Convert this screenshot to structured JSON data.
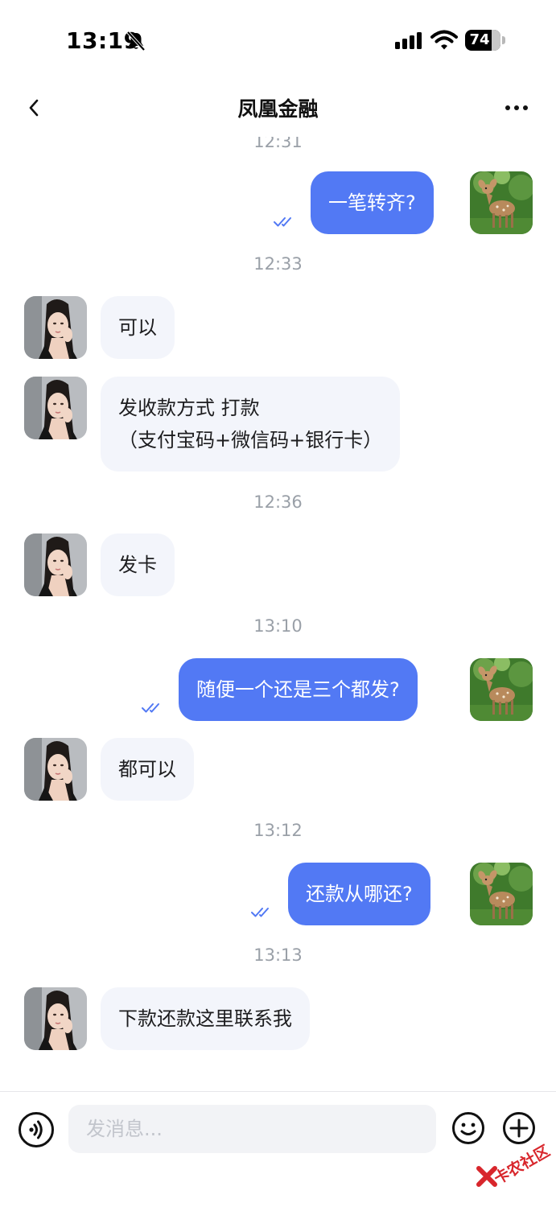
{
  "status_bar": {
    "time": "13:19",
    "battery": "74",
    "battery_fraction": 0.74
  },
  "nav": {
    "title": "凤凰金融",
    "back_icon": "chevron-left-icon",
    "more_icon": "ellipsis-icon"
  },
  "messages": [
    {
      "kind": "time",
      "text": "12:31"
    },
    {
      "kind": "out",
      "text": "一笔转齐?",
      "read": true
    },
    {
      "kind": "time",
      "text": "12:33"
    },
    {
      "kind": "in",
      "text": "可以"
    },
    {
      "kind": "in",
      "lines": [
        "发收款方式 打款",
        "（支付宝码+微信码+银行卡）"
      ]
    },
    {
      "kind": "time",
      "text": "12:36"
    },
    {
      "kind": "in",
      "text": "发卡"
    },
    {
      "kind": "time",
      "text": "13:10"
    },
    {
      "kind": "out",
      "text": "随便一个还是三个都发?",
      "read": true
    },
    {
      "kind": "in",
      "text": "都可以"
    },
    {
      "kind": "time",
      "text": "13:12"
    },
    {
      "kind": "out",
      "text": "还款从哪还?",
      "read": true
    },
    {
      "kind": "time",
      "text": "13:13"
    },
    {
      "kind": "in",
      "text": "下款还款这里联系我"
    }
  ],
  "input_bar": {
    "placeholder": "发消息...",
    "voice_icon": "voice-icon",
    "emoji_icon": "smiley-icon",
    "add_icon": "plus-circle-icon"
  },
  "watermark": {
    "text": "卡农社区"
  },
  "colors": {
    "outgoing_bubble": "#5279f4",
    "incoming_bubble": "#f3f5fb",
    "timestamp": "#9aa0a8",
    "read_check": "#5279f4"
  }
}
